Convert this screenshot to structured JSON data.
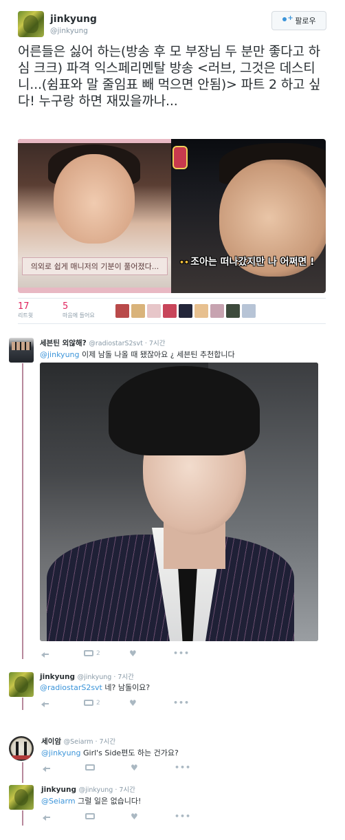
{
  "tweet": {
    "author_name": "jinkyung",
    "author_handle": "@jinkyung",
    "follow_label": "팔로우",
    "text": "어른들은 싫어 하는(방송 후 모 부장님 두 분만 좋다고 하심 크크) 파격 익스페리멘탈 방송 <러브, 그것은 데스티니...(쉼표와 말 줄임표 빼 먹으면 안됨)> 파트 2 하고 싶다! 누구랑 하면 재밌을까나...",
    "media": {
      "left_caption": "의외로 쉽게 매니저의 기분이 풀어졌다...",
      "right_caption_dots": "••",
      "right_caption": "조아는 떠나갔지만 나 어쩌면 !"
    },
    "stats": {
      "retweets": "17",
      "retweets_label": "리트윗",
      "likes": "5",
      "likes_label": "마음에 들어요"
    },
    "liker_colors": [
      "#b94a4a",
      "#d9b37a",
      "#e7c6c9",
      "#c8455a",
      "#23263a",
      "#e7c08f",
      "#c7a3b0",
      "#3d4a3c",
      "#b7c4d6"
    ]
  },
  "replies": [
    {
      "name": "세븐틴 외않해?",
      "handle": "@radiostarS2svt",
      "time": "7시간",
      "mention": "@jinkyung",
      "text": " 이제 남돌 나올 때 됐잖아요 ¿ 세븐틴 추천합니다",
      "retweet_count": "2"
    },
    {
      "name": "jinkyung",
      "handle": "@jinkyung",
      "time": "7시간",
      "mention": "@radiostarS2svt",
      "text": " 네? 남돌이요?",
      "retweet_count": "2"
    },
    {
      "name": "세이암",
      "handle": "@Seiarm",
      "time": "7시간",
      "mention": "@jinkyung",
      "text": " Girl's Side편도 하는 건가요?",
      "retweet_count": ""
    },
    {
      "name": "jinkyung",
      "handle": "@jinkyung",
      "time": "7시간",
      "mention": "@Seiarm",
      "text": " 그럴 일은 없습니다!",
      "retweet_count": ""
    }
  ],
  "icons": {
    "reply": "reply-icon",
    "retweet": "retweet-icon",
    "like": "heart-icon",
    "more": "more-icon"
  },
  "glyphs": {
    "heart": "♥",
    "more": "•••"
  }
}
